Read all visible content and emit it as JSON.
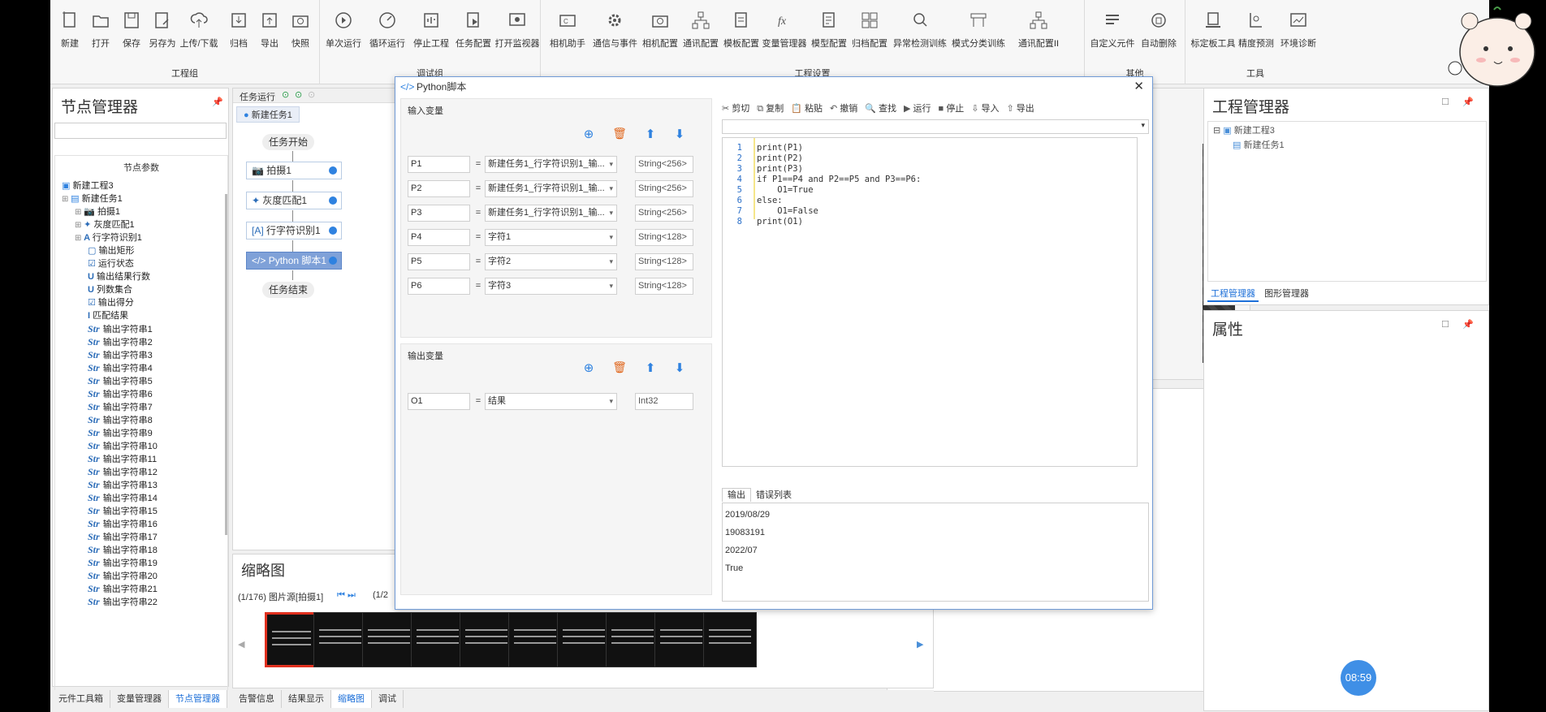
{
  "ribbon": {
    "groups": [
      {
        "label": "工程组",
        "items": [
          "新建",
          "打开",
          "保存",
          "另存为",
          "上传/下载",
          "归档",
          "导出",
          "快照"
        ]
      },
      {
        "label": "调试组",
        "items": [
          "单次运行",
          "循环运行",
          "停止工程",
          "任务配置",
          "打开监视器"
        ]
      },
      {
        "label": "工程设置",
        "items": [
          "相机助手",
          "通信与事件",
          "相机配置",
          "通讯配置",
          "模板配置",
          "变量管理器",
          "模型配置",
          "归档配置",
          "异常检测训练",
          "模式分类训练",
          "通讯配置II"
        ]
      },
      {
        "label": "其他",
        "items": [
          "自定义元件",
          "自动删除"
        ]
      },
      {
        "label": "工具",
        "items": [
          "标定板工具",
          "精度预测",
          "环境诊断"
        ]
      }
    ]
  },
  "node_manager": {
    "title": "节点管理器",
    "header": "节点参数",
    "tree": [
      {
        "label": "新建工程3",
        "indent": 0,
        "icon": "project-icon"
      },
      {
        "label": "新建任务1",
        "indent": 0,
        "icon": "task-icon"
      },
      {
        "label": "拍摄1",
        "indent": 1,
        "icon": "camera-icon"
      },
      {
        "label": "灰度匹配1",
        "indent": 1,
        "icon": "match-icon"
      },
      {
        "label": "行字符识别1",
        "indent": 1,
        "icon": "ocr-icon"
      },
      {
        "label": "输出矩形",
        "indent": 2,
        "icon": "rect-icon"
      },
      {
        "label": "运行状态",
        "indent": 2,
        "icon": "check-icon"
      },
      {
        "label": "输出结果行数",
        "indent": 2,
        "icon": "u32-icon"
      },
      {
        "label": "列数集合",
        "indent": 2,
        "icon": "u32-icon"
      },
      {
        "label": "输出得分",
        "indent": 2,
        "icon": "check-icon"
      },
      {
        "label": "匹配结果",
        "indent": 2,
        "icon": "i32-icon"
      },
      {
        "label": "输出字符串1",
        "indent": 2,
        "icon": "str-icon"
      },
      {
        "label": "输出字符串2",
        "indent": 2,
        "icon": "str-icon"
      },
      {
        "label": "输出字符串3",
        "indent": 2,
        "icon": "str-icon"
      },
      {
        "label": "输出字符串4",
        "indent": 2,
        "icon": "str-icon"
      },
      {
        "label": "输出字符串5",
        "indent": 2,
        "icon": "str-icon"
      },
      {
        "label": "输出字符串6",
        "indent": 2,
        "icon": "str-icon"
      },
      {
        "label": "输出字符串7",
        "indent": 2,
        "icon": "str-icon"
      },
      {
        "label": "输出字符串8",
        "indent": 2,
        "icon": "str-icon"
      },
      {
        "label": "输出字符串9",
        "indent": 2,
        "icon": "str-icon"
      },
      {
        "label": "输出字符串10",
        "indent": 2,
        "icon": "str-icon"
      },
      {
        "label": "输出字符串11",
        "indent": 2,
        "icon": "str-icon"
      },
      {
        "label": "输出字符串12",
        "indent": 2,
        "icon": "str-icon"
      },
      {
        "label": "输出字符串13",
        "indent": 2,
        "icon": "str-icon"
      },
      {
        "label": "输出字符串14",
        "indent": 2,
        "icon": "str-icon"
      },
      {
        "label": "输出字符串15",
        "indent": 2,
        "icon": "str-icon"
      },
      {
        "label": "输出字符串16",
        "indent": 2,
        "icon": "str-icon"
      },
      {
        "label": "输出字符串17",
        "indent": 2,
        "icon": "str-icon"
      },
      {
        "label": "输出字符串18",
        "indent": 2,
        "icon": "str-icon"
      },
      {
        "label": "输出字符串19",
        "indent": 2,
        "icon": "str-icon"
      },
      {
        "label": "输出字符串20",
        "indent": 2,
        "icon": "str-icon"
      },
      {
        "label": "输出字符串21",
        "indent": 2,
        "icon": "str-icon"
      },
      {
        "label": "输出字符串22",
        "indent": 2,
        "icon": "str-icon"
      }
    ],
    "bottom_tabs": [
      "元件工具箱",
      "变量管理器",
      "节点管理器"
    ]
  },
  "task_flow": {
    "toolbar_label": "任务运行",
    "tab": "新建任务1",
    "start": "任务开始",
    "end": "任务结束",
    "nodes": [
      "拍摄1",
      "灰度匹配1",
      "行字符识别1",
      "Python 脚本1"
    ]
  },
  "thumbnail": {
    "title": "缩略图",
    "info": "(1/176) 图片源[拍摄1]",
    "nav_partial": "(1/2",
    "bottom_tabs": [
      "告警信息",
      "结果显示",
      "缩略图",
      "调试"
    ]
  },
  "dialog": {
    "title": "Python脚本",
    "input_title": "输入变量",
    "output_title": "输出变量",
    "inputs": [
      {
        "name": "P1",
        "source": "新建任务1_行字符识别1_输...",
        "type": "String<256>"
      },
      {
        "name": "P2",
        "source": "新建任务1_行字符识别1_输...",
        "type": "String<256>"
      },
      {
        "name": "P3",
        "source": "新建任务1_行字符识别1_输...",
        "type": "String<256>"
      },
      {
        "name": "P4",
        "source": "字符1",
        "type": "String<128>"
      },
      {
        "name": "P5",
        "source": "字符2",
        "type": "String<128>"
      },
      {
        "name": "P6",
        "source": "字符3",
        "type": "String<128>"
      }
    ],
    "outputs": [
      {
        "name": "O1",
        "source": "结果",
        "type": "Int32"
      }
    ],
    "editor_toolbar": [
      "剪切",
      "复制",
      "粘贴",
      "撤销",
      "查找",
      "运行",
      "停止",
      "导入",
      "导出"
    ],
    "code": [
      "print(P1)",
      "print(P2)",
      "print(P3)",
      "if P1==P4 and P2==P5 and P3==P6:",
      "    O1=True",
      "else:",
      "    O1=False",
      "print(O1)"
    ],
    "output_tabs": [
      "输出",
      "错误列表"
    ],
    "output_lines": [
      "2019/08/29",
      "19083191",
      "2022/07",
      "True"
    ]
  },
  "project_manager": {
    "title": "工程管理器",
    "tree": [
      "新建工程3",
      "新建任务1"
    ],
    "tabs": [
      "工程管理器",
      "图形管理器"
    ]
  },
  "properties": {
    "title": "属性"
  },
  "timer": "08:59",
  "colors": {
    "accent": "#1c6fd8",
    "node_dot": "#2f82e0",
    "delete": "#e0661c",
    "selected_node": "#7fa1d8"
  }
}
